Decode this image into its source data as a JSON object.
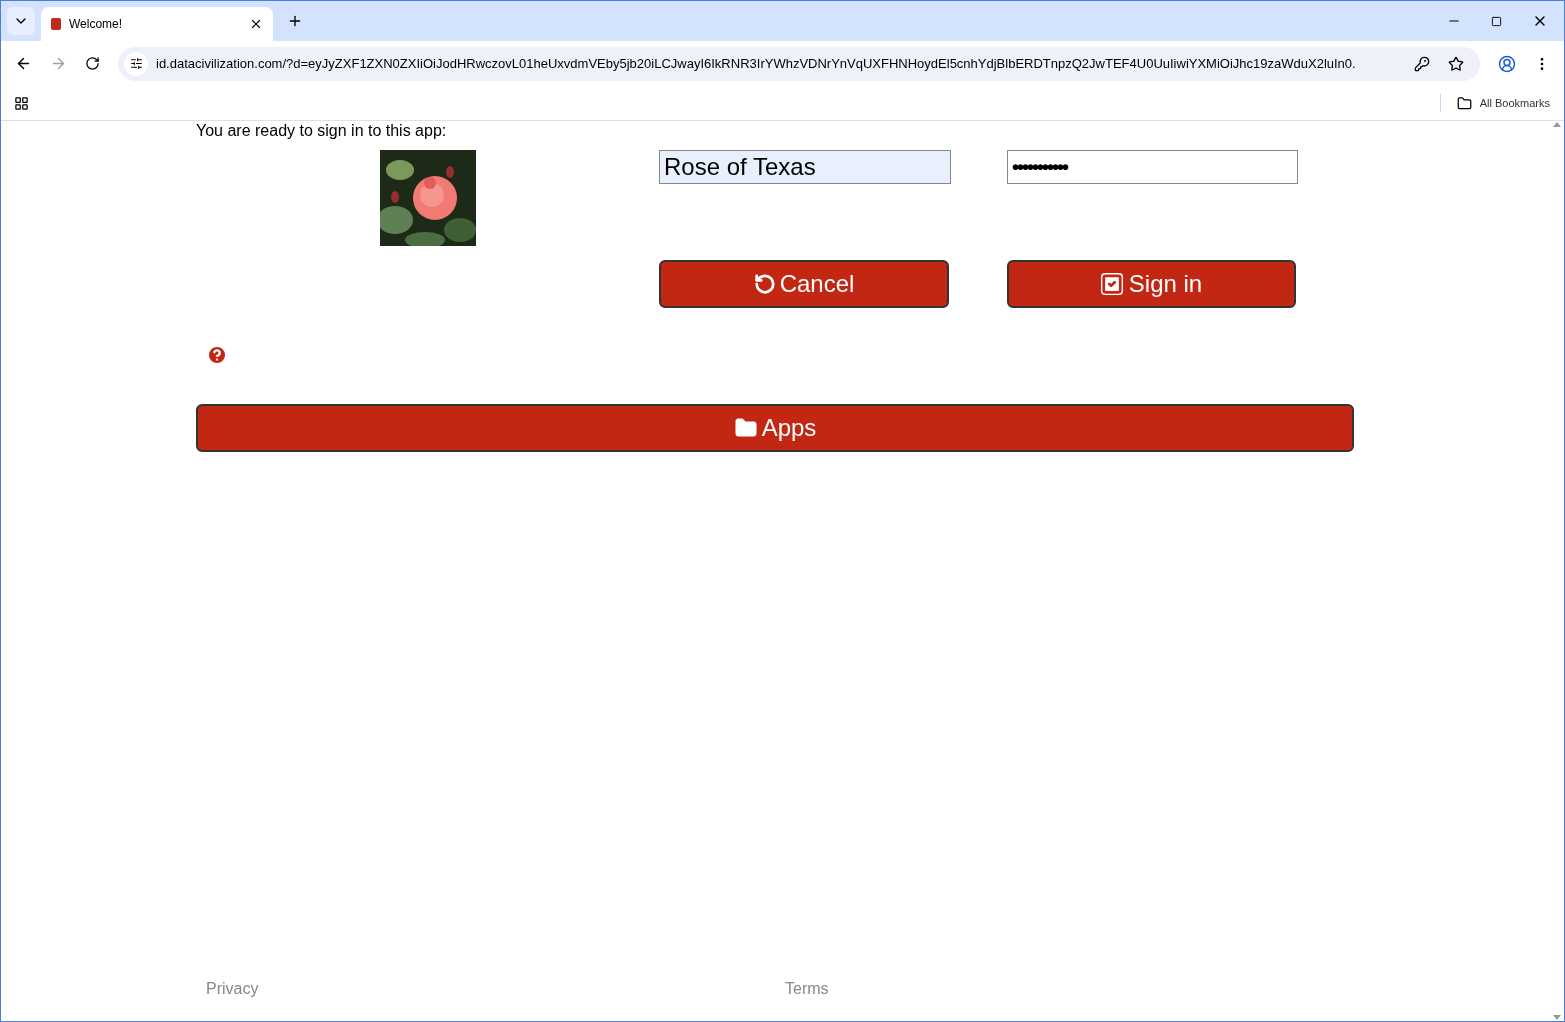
{
  "browser": {
    "tab": {
      "title": "Welcome!",
      "selected": true
    },
    "address": "id.datacivilization.com/?d=eyJyZXF1ZXN0ZXIiOiJodHRwczovL01heUxvdmVEby5jb20iLCJwayI6IkRNR3IrYWhzVDNrYnVqUXFHNHoydEl5cnhYdjBlbERDTnpzQ2JwTEF4U0UuIiwiYXMiOiJhc19zaWduX2luIn0.",
    "bookmarks_label": "All Bookmarks"
  },
  "page": {
    "intro": "You are ready to sign in to this app:",
    "username": {
      "value": "Rose of Texas",
      "autofilled": true
    },
    "password": {
      "value": "•••••••••••"
    },
    "cancel_button": "Cancel",
    "sign_in_button": "Sign in",
    "apps_button": "Apps",
    "footer": [
      "Privacy",
      "Terms"
    ]
  }
}
